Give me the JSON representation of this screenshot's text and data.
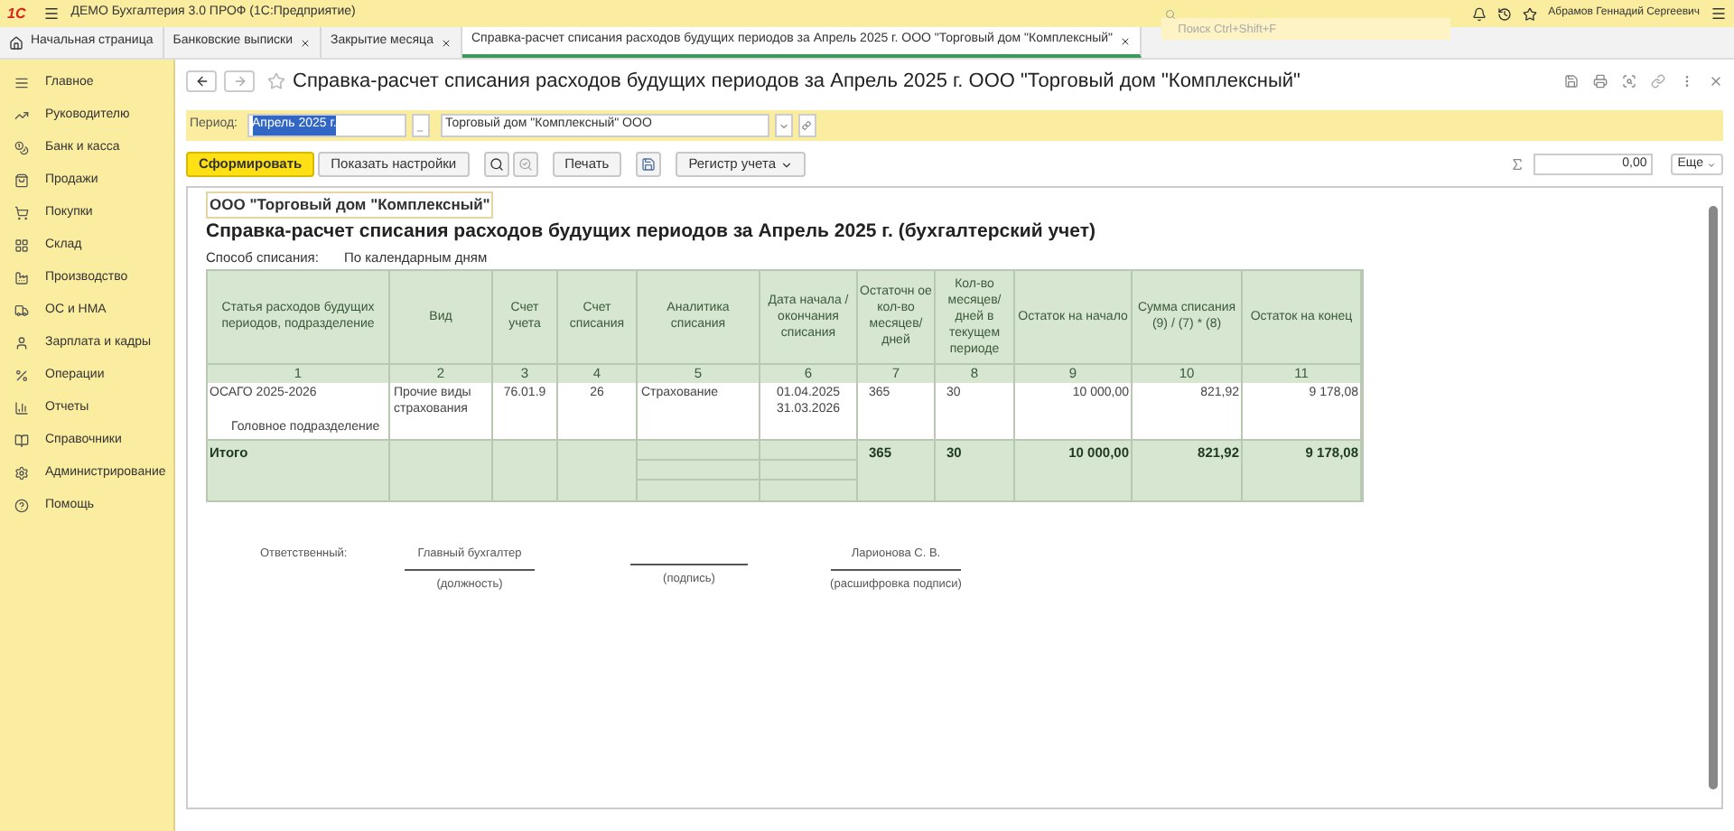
{
  "app": {
    "logo": "1С",
    "title": "ДЕМО Бухгалтерия 3.0 ПРОФ  (1С:Предприятие)",
    "search_placeholder": "Поиск Ctrl+Shift+F",
    "user": "Абрамов Геннадий Сергеевич"
  },
  "tabs": [
    {
      "label": "Начальная страница",
      "kind": "home",
      "selected": false
    },
    {
      "label": "Банковские выписки",
      "kind": "closable",
      "selected": false
    },
    {
      "label": "Закрытие месяца",
      "kind": "closable",
      "selected": false
    },
    {
      "label": "Справка-расчет списания расходов будущих периодов за Апрель 2025 г. ООО \"Торговый дом \"Комплексный\"",
      "kind": "closable",
      "selected": true
    }
  ],
  "sidebar": {
    "items": [
      {
        "label": "Главное"
      },
      {
        "label": "Руководителю"
      },
      {
        "label": "Банк и касса"
      },
      {
        "label": "Продажи"
      },
      {
        "label": "Покупки"
      },
      {
        "label": "Склад"
      },
      {
        "label": "Производство"
      },
      {
        "label": "ОС и НМА"
      },
      {
        "label": "Зарплата и кадры"
      },
      {
        "label": "Операции"
      },
      {
        "label": "Отчеты"
      },
      {
        "label": "Справочники"
      },
      {
        "label": "Администрирование"
      },
      {
        "label": "Помощь"
      }
    ]
  },
  "form": {
    "title": "Справка-расчет списания расходов будущих периодов за Апрель 2025 г. ООО \"Торговый дом \"Комплексный\"",
    "period_label": "Период:",
    "period_value": "Апрель 2025 г.",
    "period_highlighted": true,
    "organization": "Торговый дом \"Комплексный\" ООО",
    "buttons": [
      {
        "label": "Сформировать",
        "kind": "primary"
      },
      {
        "label": "Показать настройки",
        "kind": "plain"
      },
      {
        "kind": "search"
      },
      {
        "kind": "find-next"
      },
      {
        "label": "Печать",
        "kind": "plain"
      },
      {
        "kind": "save"
      },
      {
        "label": "Регистр учета",
        "kind": "dropdown"
      }
    ],
    "sum_value": "0,00",
    "more": "Еще"
  },
  "report": {
    "organization": "ООО \"Торговый дом \"Комплексный\"",
    "title": "Справка-расчет списания расходов будущих периодов за Апрель 2025 г. (бухгалтерский учет)",
    "method_label": "Способ списания:",
    "method_value": "По календарным дням",
    "columns": [
      {
        "title": "Статья расходов будущих периодов, подразделение",
        "number": "1"
      },
      {
        "title": "Вид",
        "number": "2"
      },
      {
        "title": "Счет учета",
        "number": "3"
      },
      {
        "title": "Счет списания",
        "number": "4"
      },
      {
        "title": "Аналитика списания",
        "number": "5"
      },
      {
        "title": "Дата начала / окончания списания",
        "number": "6"
      },
      {
        "title": "Остаточн ое кол-во месяцев/ дней",
        "number": "7"
      },
      {
        "title": "Кол-во месяцев/ дней в текущем периоде",
        "number": "8"
      },
      {
        "title": "Остаток на начало",
        "number": "9"
      },
      {
        "title": "Сумма списания (9) / (7) * (8)",
        "number": "10"
      },
      {
        "title": "Остаток на конец",
        "number": "11"
      }
    ],
    "rows": [
      {
        "article": "ОСАГО 2025-2026",
        "subdivision": "Головное подразделение",
        "kind_text": "Прочие виды страхования",
        "account": "76.01.9",
        "writeoff_account": "26",
        "analytics": "Страхование",
        "start_date": "01.04.2025",
        "end_date": "31.03.2026",
        "remaining": "365",
        "current": "30",
        "start_balance": "10 000,00",
        "amount": "821,92",
        "end_balance": "9 178,08"
      }
    ],
    "total": {
      "label": "Итого",
      "remaining": "365",
      "current": "30",
      "start_balance": "10 000,00",
      "amount": "821,92",
      "end_balance": "9 178,08"
    },
    "signatures": {
      "responsible": "Ответственный:",
      "position": "Главный бухгалтер",
      "position_caption": "(должность)",
      "signature_caption": "(подпись)",
      "name": "Ларионова С. В.",
      "name_caption": "(расшифровка подписи)"
    }
  }
}
